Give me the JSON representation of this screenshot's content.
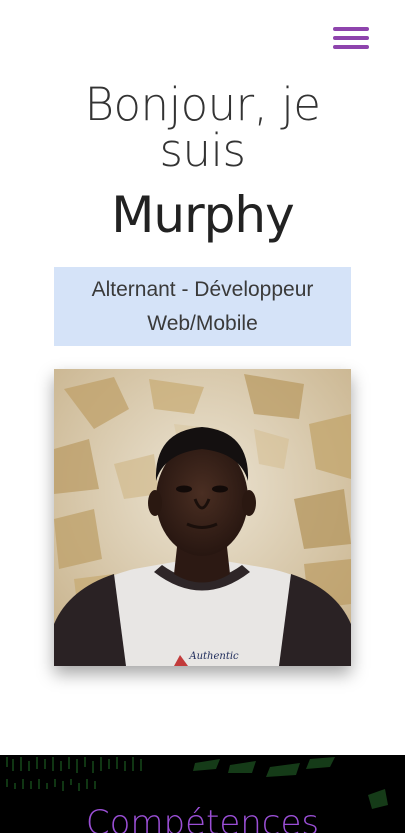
{
  "header": {
    "menu_icon": "hamburger-menu-icon",
    "accent_color": "#8e44ad"
  },
  "hero": {
    "greeting": "Bonjour, je suis",
    "name": "Murphy",
    "role": "Alternant - Développeur Web/Mobile",
    "role_bg_color": "#d5e3f8"
  },
  "profile_photo": {
    "visible_shirt_text": "Authentic"
  },
  "skills_section": {
    "heading": "Compétences",
    "heading_color": "#9b4fd6"
  }
}
